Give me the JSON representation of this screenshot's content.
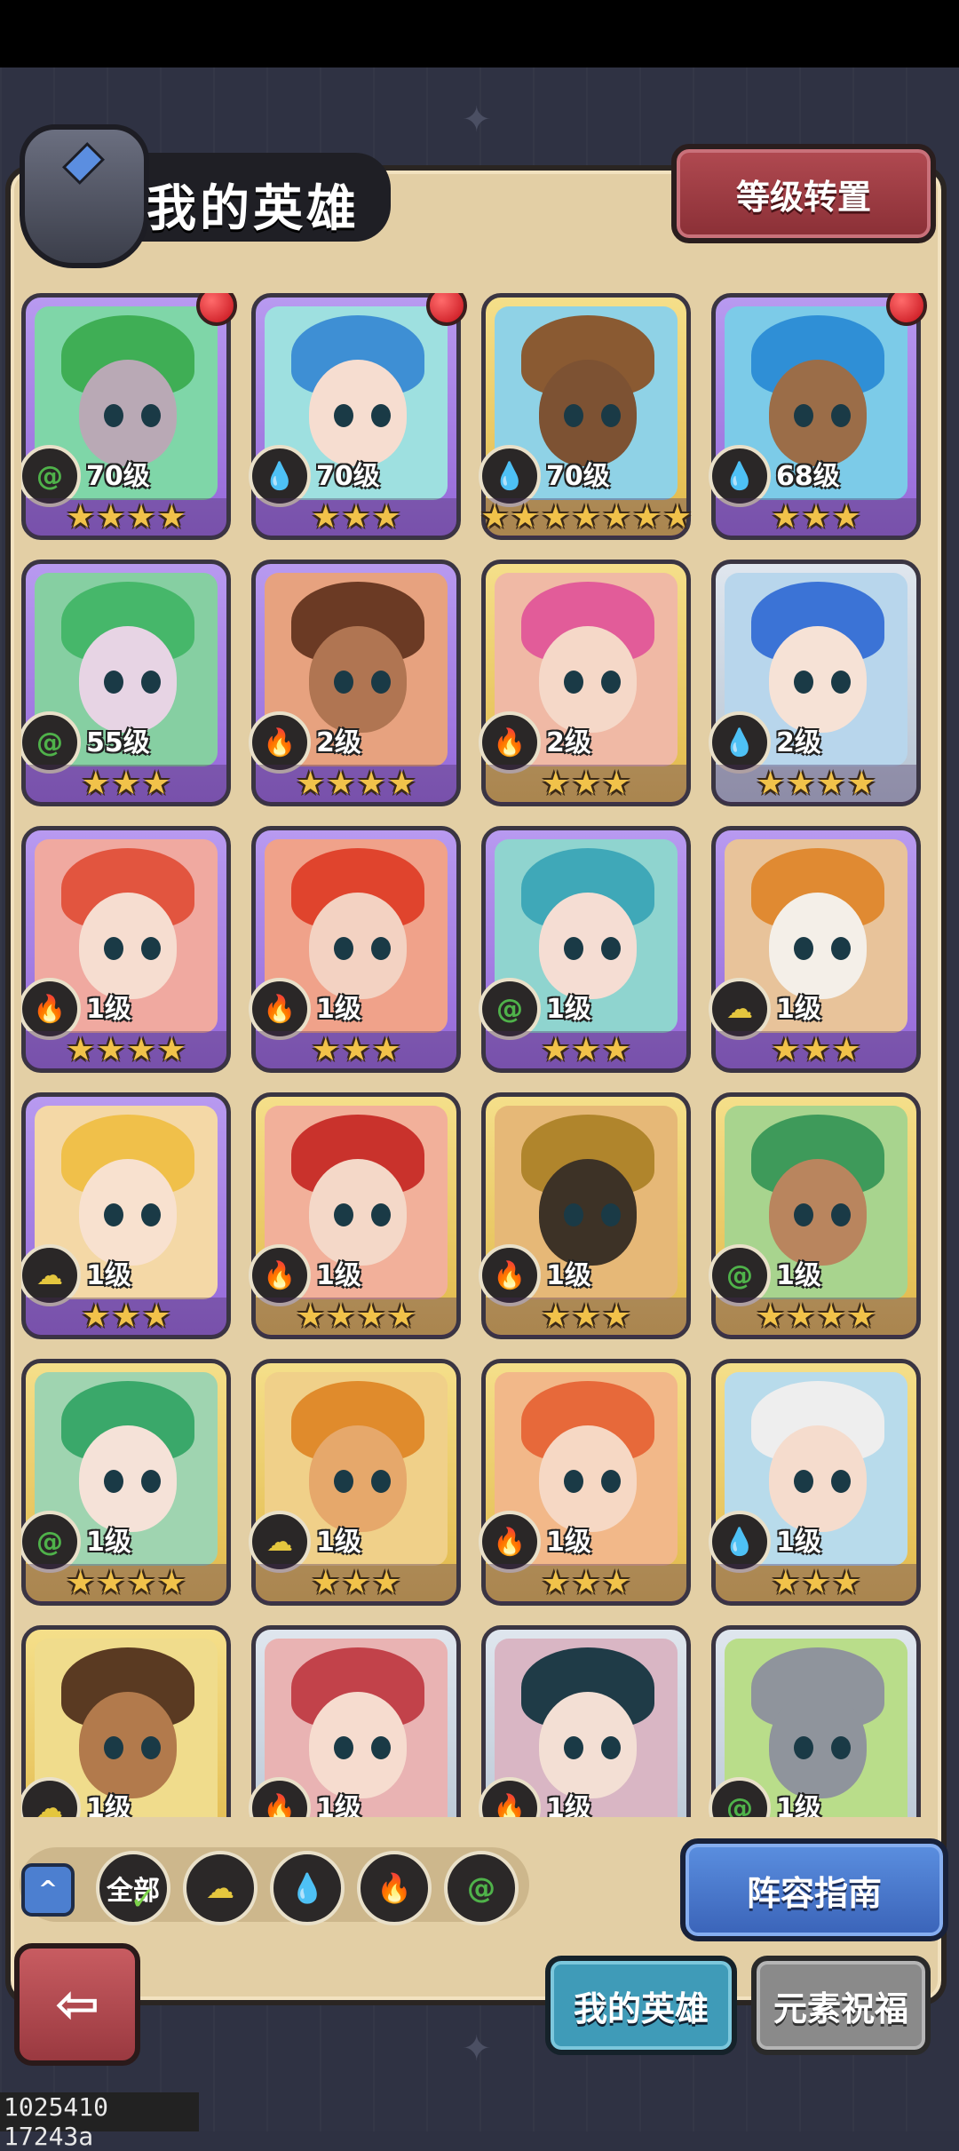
{
  "header": {
    "title": "我的英雄",
    "level_transfer_button": "等级转置"
  },
  "element_colors": {
    "nature": "#4fb24a",
    "water": "#3f8ee0",
    "fire": "#e0524f",
    "light": "#e4c63e"
  },
  "heroes": [
    {
      "level": "70级",
      "element": "nature",
      "rarity": "epic",
      "stars": "★★★★",
      "notify": true,
      "hair": "#3fae55",
      "skin": "#b9a9b5",
      "bg": "#7fd6a8"
    },
    {
      "level": "70级",
      "element": "water",
      "rarity": "epic",
      "stars": "★★★",
      "notify": true,
      "hair": "#3e8fd4",
      "skin": "#f6ddd0",
      "bg": "#9ee0e0"
    },
    {
      "level": "70级",
      "element": "water",
      "rarity": "legend",
      "stars": "★★★★★★★",
      "notify": false,
      "hair": "#8a5a32",
      "skin": "#7d5233",
      "bg": "#8fd2e6"
    },
    {
      "level": "68级",
      "element": "water",
      "rarity": "epic",
      "stars": "★★★",
      "notify": true,
      "hair": "#2f8fd6",
      "skin": "#9b6d48",
      "bg": "#7ccbe8"
    },
    {
      "level": "55级",
      "element": "nature",
      "rarity": "epic",
      "stars": "★★★",
      "notify": false,
      "hair": "#46b76a",
      "skin": "#e7d4e4",
      "bg": "#86cfa2"
    },
    {
      "level": "2级",
      "element": "fire",
      "rarity": "epic",
      "stars": "★★★★",
      "notify": false,
      "hair": "#6b3a24",
      "skin": "#b07552",
      "bg": "#e7a27f"
    },
    {
      "level": "2级",
      "element": "fire",
      "rarity": "legend",
      "stars": "★★★",
      "notify": false,
      "hair": "#e25c99",
      "skin": "#f5d8c8",
      "bg": "#f0b9a5"
    },
    {
      "level": "2级",
      "element": "water",
      "rarity": "rare",
      "stars": "★★★★",
      "notify": false,
      "hair": "#3b73d6",
      "skin": "#f6e2d6",
      "bg": "#b8d6ec"
    },
    {
      "level": "1级",
      "element": "fire",
      "rarity": "epic",
      "stars": "★★★★",
      "notify": false,
      "hair": "#e2553f",
      "skin": "#f6ddd0",
      "bg": "#f0a9a0"
    },
    {
      "level": "1级",
      "element": "fire",
      "rarity": "epic",
      "stars": "★★★",
      "notify": false,
      "hair": "#e0442d",
      "skin": "#f3d2c2",
      "bg": "#f0a28a"
    },
    {
      "level": "1级",
      "element": "nature",
      "rarity": "epic",
      "stars": "★★★",
      "notify": false,
      "hair": "#3fa8b8",
      "skin": "#f5ddd3",
      "bg": "#8fd4cf"
    },
    {
      "level": "1级",
      "element": "light",
      "rarity": "epic",
      "stars": "★★★",
      "notify": false,
      "hair": "#e08a32",
      "skin": "#f4efe8",
      "bg": "#e8c39a"
    },
    {
      "level": "1级",
      "element": "light",
      "rarity": "epic",
      "stars": "★★★",
      "notify": false,
      "hair": "#f0c04a",
      "skin": "#f8e1cf",
      "bg": "#f4d8a6"
    },
    {
      "level": "1级",
      "element": "fire",
      "rarity": "legend",
      "stars": "★★★★",
      "notify": false,
      "hair": "#c9322c",
      "skin": "#f4d8c8",
      "bg": "#f2b09a"
    },
    {
      "level": "1级",
      "element": "fire",
      "rarity": "legend",
      "stars": "★★★",
      "notify": false,
      "hair": "#b0852c",
      "skin": "#3d3226",
      "bg": "#e6b877"
    },
    {
      "level": "1级",
      "element": "nature",
      "rarity": "legend",
      "stars": "★★★★",
      "notify": false,
      "hair": "#3e9a5a",
      "skin": "#b9855e",
      "bg": "#a8d48e"
    },
    {
      "level": "1级",
      "element": "nature",
      "rarity": "legend",
      "stars": "★★★★",
      "notify": false,
      "hair": "#3aa86a",
      "skin": "#f5e2d8",
      "bg": "#9fd4b0"
    },
    {
      "level": "1级",
      "element": "light",
      "rarity": "legend",
      "stars": "★★★",
      "notify": false,
      "hair": "#e08b2c",
      "skin": "#e6a86b",
      "bg": "#f0d089"
    },
    {
      "level": "1级",
      "element": "fire",
      "rarity": "legend",
      "stars": "★★★",
      "notify": false,
      "hair": "#e7693a",
      "skin": "#f6d8c4",
      "bg": "#f2b889"
    },
    {
      "level": "1级",
      "element": "water",
      "rarity": "legend",
      "stars": "★★★",
      "notify": false,
      "hair": "#eeeeee",
      "skin": "#f5dccd",
      "bg": "#b8dbeb"
    },
    {
      "level": "1级",
      "element": "light",
      "rarity": "legend",
      "stars": "",
      "notify": false,
      "hair": "#5a3a22",
      "skin": "#b27a4c",
      "bg": "#f0dc8c"
    },
    {
      "level": "1级",
      "element": "fire",
      "rarity": "rare",
      "stars": "",
      "notify": false,
      "hair": "#c2424a",
      "skin": "#f6dccf",
      "bg": "#e9b3b3"
    },
    {
      "level": "1级",
      "element": "fire",
      "rarity": "rare",
      "stars": "",
      "notify": false,
      "hair": "#1f3b47",
      "skin": "#f3dfd4",
      "bg": "#d9b6c4"
    },
    {
      "level": "1级",
      "element": "nature",
      "rarity": "rare",
      "stars": "",
      "notify": false,
      "hair": "#8f949c",
      "skin": "#8f949c",
      "bg": "#b9dd8a"
    }
  ],
  "filters": {
    "all_label": "全部",
    "items": [
      "light",
      "water",
      "fire",
      "nature"
    ]
  },
  "footer": {
    "lineup_guide_button": "阵容指南",
    "tab_my_heroes": "我的英雄",
    "tab_element_blessing": "元素祝福"
  },
  "debug_text": "1025410 17243a"
}
